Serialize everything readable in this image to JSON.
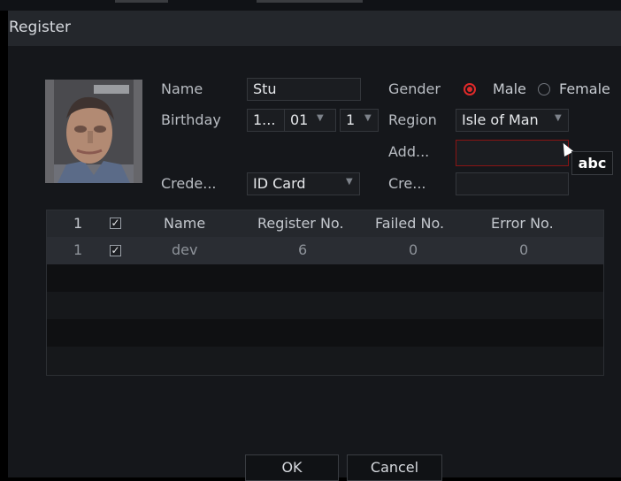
{
  "dialog": {
    "title": "Register",
    "ok_label": "OK",
    "cancel_label": "Cancel"
  },
  "form": {
    "name_label": "Name",
    "name_value": "Stu",
    "gender_label": "Gender",
    "gender_options": [
      "Male",
      "Female"
    ],
    "gender_selected": "Male",
    "birthday_label": "Birthday",
    "birthday_year": "1...",
    "birthday_month": "01",
    "birthday_day": "1",
    "region_label": "Region",
    "region_value": "Isle of Man",
    "address_label": "Add...",
    "address_value": "",
    "credential_type_label": "Crede...",
    "credential_type_value": "ID Card",
    "credential_no_label": "Cre...",
    "credential_no_value": "",
    "keyboard_hint": "abc"
  },
  "table": {
    "headers": [
      "1",
      "✓",
      "Name",
      "Register No.",
      "Failed No.",
      "Error No."
    ],
    "rows": [
      {
        "index": "1",
        "checked": "✓",
        "name": "dev",
        "register_no": "6",
        "failed_no": "0",
        "error_no": "0"
      }
    ]
  },
  "colors": {
    "accent_red": "#e02a2a",
    "dialog_bg": "#15171b",
    "titlebar_bg": "#24272c"
  }
}
